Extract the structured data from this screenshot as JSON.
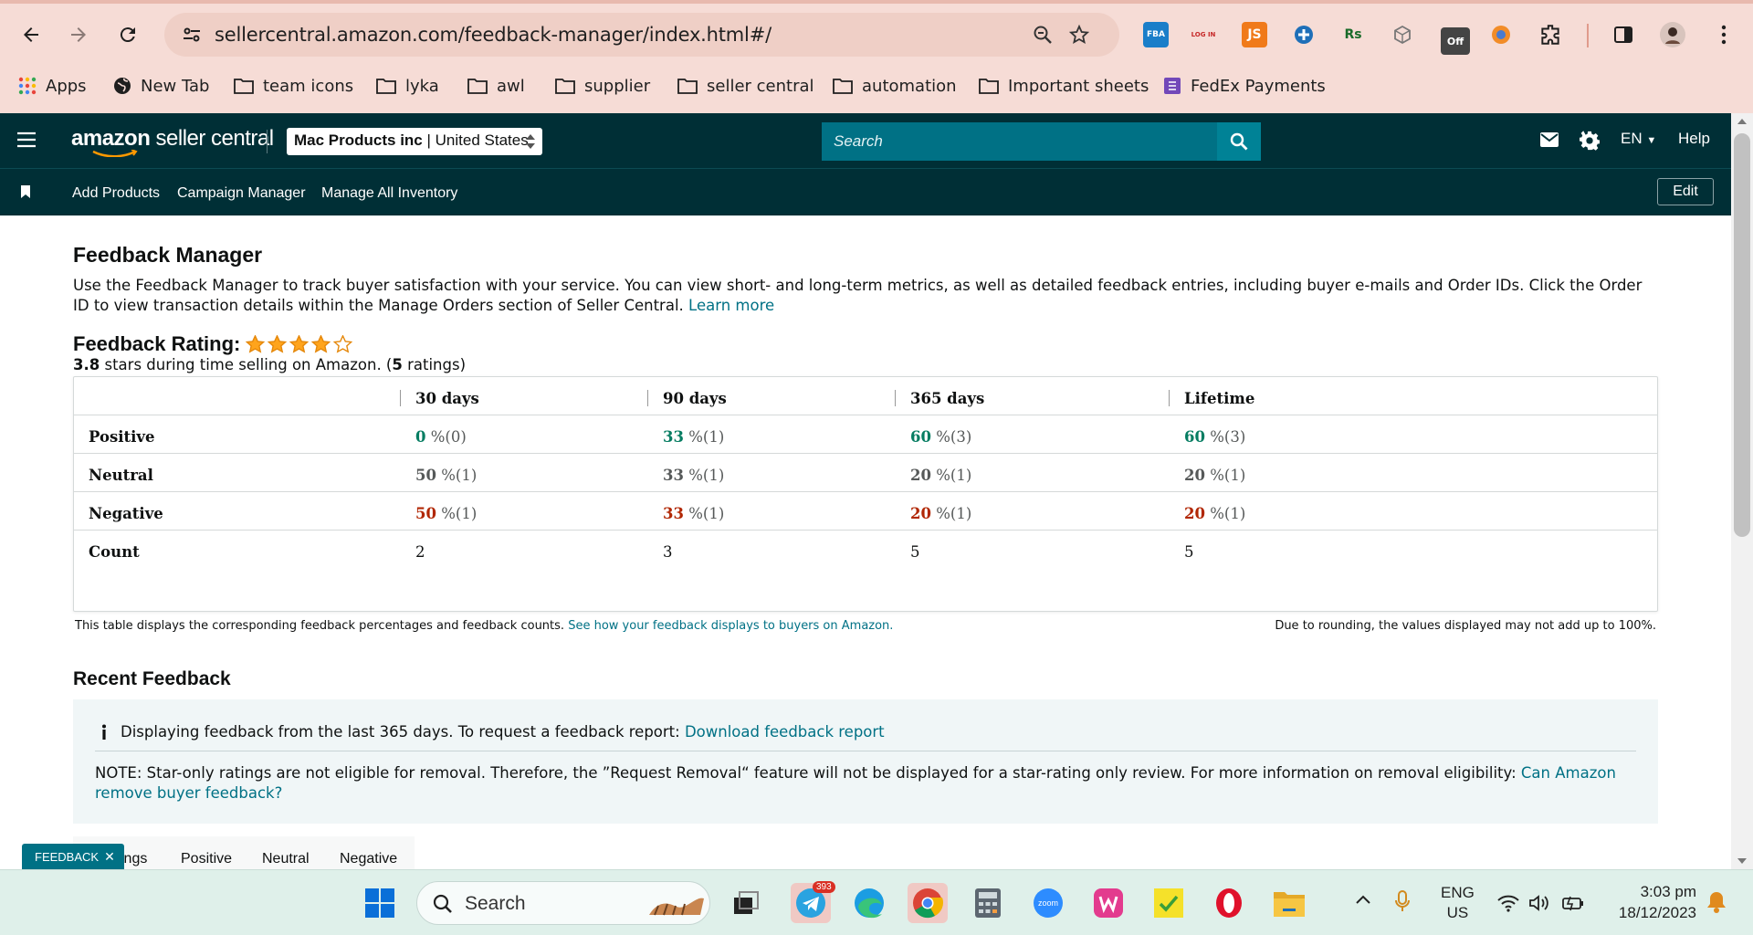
{
  "browser": {
    "url": "sellercentral.amazon.com/feedback-manager/index.html#/",
    "bookmarks": [
      "Apps",
      "New Tab",
      "team icons",
      "lyka",
      "awl",
      "supplier",
      "seller central",
      "automation",
      "Important sheets",
      "FedEx Payments"
    ],
    "ext_labels": {
      "fba": "FBA",
      "login": "LOG IN",
      "js": "JS",
      "rs": "Rs",
      "off": "Off"
    }
  },
  "sc": {
    "logo_bold": "amazon",
    "logo_rest": " seller central",
    "store": "Mac Products inc",
    "country": "United States",
    "search_placeholder": "Search",
    "lang": "EN",
    "help": "Help",
    "nav": [
      "Add Products",
      "Campaign Manager",
      "Manage All Inventory"
    ],
    "edit": "Edit"
  },
  "page": {
    "title": "Feedback Manager",
    "desc": "Use the Feedback Manager to track buyer satisfaction with your service. You can view short- and long-term metrics, as well as detailed feedback entries, including buyer e-mails and Order IDs. Click the Order ID to view transaction details within the Manage Orders section of Seller Central.",
    "learn_more": "Learn more",
    "rating_label": "Feedback Rating:",
    "rating_stars": 3.8,
    "rating_value": "3.8",
    "rating_mid": " stars during time selling on Amazon. (",
    "rating_count": "5",
    "rating_end": " ratings)"
  },
  "table": {
    "headers": [
      "30 days",
      "90 days",
      "365 days",
      "Lifetime"
    ],
    "rows": [
      {
        "label": "Positive",
        "kind": "g",
        "cells": [
          [
            "0",
            " %(0)"
          ],
          [
            "33",
            " %(1)"
          ],
          [
            "60",
            " %(3)"
          ],
          [
            "60",
            " %(3)"
          ]
        ]
      },
      {
        "label": "Neutral",
        "kind": "n",
        "cells": [
          [
            "50",
            " %(1)"
          ],
          [
            "33",
            " %(1)"
          ],
          [
            "20",
            " %(1)"
          ],
          [
            "20",
            " %(1)"
          ]
        ]
      },
      {
        "label": "Negative",
        "kind": "r",
        "cells": [
          [
            "50",
            " %(1)"
          ],
          [
            "33",
            " %(1)"
          ],
          [
            "20",
            " %(1)"
          ],
          [
            "20",
            " %(1)"
          ]
        ]
      },
      {
        "label": "Count",
        "kind": "c",
        "cells": [
          [
            "2",
            ""
          ],
          [
            "3",
            ""
          ],
          [
            "5",
            ""
          ],
          [
            "5",
            ""
          ]
        ]
      }
    ],
    "note_left": "This table displays the corresponding feedback percentages and feedback counts.",
    "note_link": "See how your feedback displays to buyers on Amazon.",
    "note_right": "Due to rounding, the values displayed may not add up to 100%."
  },
  "recent": {
    "title": "Recent Feedback",
    "info": "Displaying feedback from the last 365 days. To request a feedback report:",
    "info_link": "Download feedback report",
    "note": "NOTE: Star-only ratings are not eligible for removal. Therefore, the ”Request Removal“ feature will not be displayed for a star-rating only review. For more information on removal eligibility:",
    "note_link": "Can Amazon remove buyer feedback?",
    "tabs": [
      "ings",
      "Positive",
      "Neutral",
      "Negative"
    ],
    "feedback_tab": "FEEDBACK"
  },
  "taskbar": {
    "search": "Search",
    "telegram_badge": "393",
    "zoom_label": "zoom",
    "lang1": "ENG",
    "lang2": "US",
    "time": "3:03 pm",
    "date": "18/12/2023"
  }
}
